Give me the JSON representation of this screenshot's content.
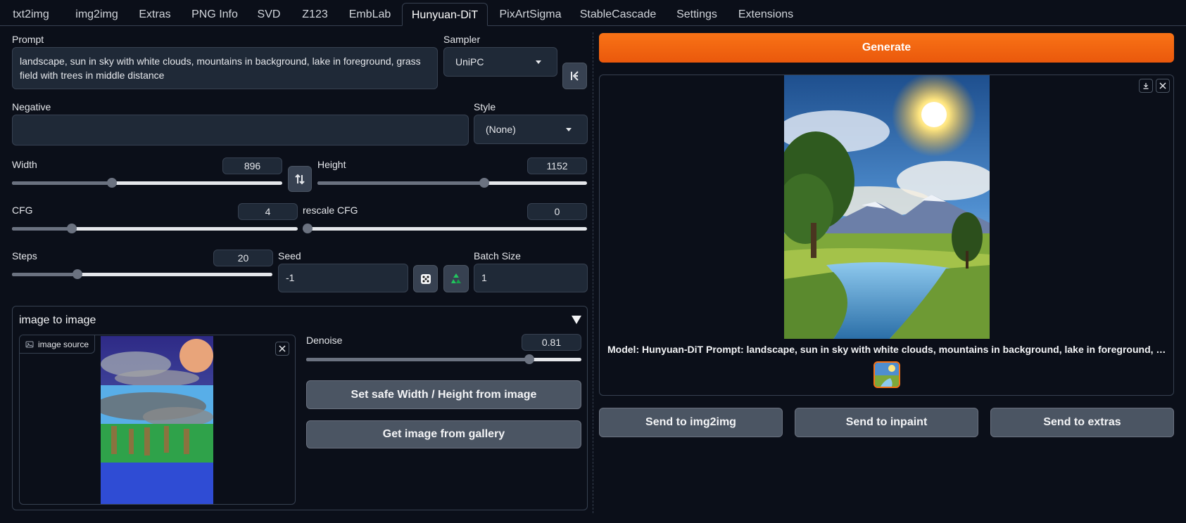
{
  "tabs": [
    {
      "label": "txt2img"
    },
    {
      "label": "img2img"
    },
    {
      "label": "Extras"
    },
    {
      "label": "PNG Info"
    },
    {
      "label": "SVD"
    },
    {
      "label": "Z123"
    },
    {
      "label": "EmbLab"
    },
    {
      "label": "Hunyuan-DiT"
    },
    {
      "label": "PixArtSigma"
    },
    {
      "label": "StableCascade"
    },
    {
      "label": "Settings"
    },
    {
      "label": "Extensions"
    }
  ],
  "active_tab": "Hunyuan-DiT",
  "prompt": {
    "label": "Prompt",
    "value": "landscape, sun in sky with white clouds, mountains in background, lake in foreground, grass field with trees in middle distance"
  },
  "sampler": {
    "label": "Sampler",
    "value": "UniPC"
  },
  "negative": {
    "label": "Negative",
    "value": ""
  },
  "style": {
    "label": "Style",
    "value": "(None)"
  },
  "width": {
    "label": "Width",
    "value": "896",
    "fraction": 0.37
  },
  "height": {
    "label": "Height",
    "value": "1152",
    "fraction": 0.62
  },
  "cfg": {
    "label": "CFG",
    "value": "4",
    "fraction": 0.21
  },
  "rescale_cfg": {
    "label": "rescale CFG",
    "value": "0",
    "fraction": 0.0
  },
  "steps": {
    "label": "Steps",
    "value": "20",
    "fraction": 0.25
  },
  "seed": {
    "label": "Seed",
    "value": "-1"
  },
  "batch_size": {
    "label": "Batch Size",
    "value": "1"
  },
  "img2img": {
    "title": "image to image",
    "source_label": "image source",
    "denoise": {
      "label": "Denoise",
      "value": "0.81",
      "fraction": 0.81
    },
    "safe_size_button": "Set safe Width / Height from image",
    "gallery_button": "Get image from gallery"
  },
  "generate_label": "Generate",
  "output": {
    "caption": "Model: Hunyuan-DiT Prompt: landscape, sun in sky with white clouds, mountains in background, lake in foreground, grass field with trees in middle distance"
  },
  "send_buttons": {
    "img2img": "Send to img2img",
    "inpaint": "Send to inpaint",
    "extras": "Send to extras"
  },
  "colors": {
    "background": "#0b0f19",
    "accent": "#ea580c",
    "button": "#4b5563"
  },
  "icons": {
    "swap": "swap-vertical-icon",
    "random": "dice-icon",
    "reuse": "recycle-icon",
    "expand": "chevrons-icon",
    "download": "download-icon",
    "close": "close-icon",
    "image": "image-icon",
    "collapse": "triangle-down-icon"
  }
}
